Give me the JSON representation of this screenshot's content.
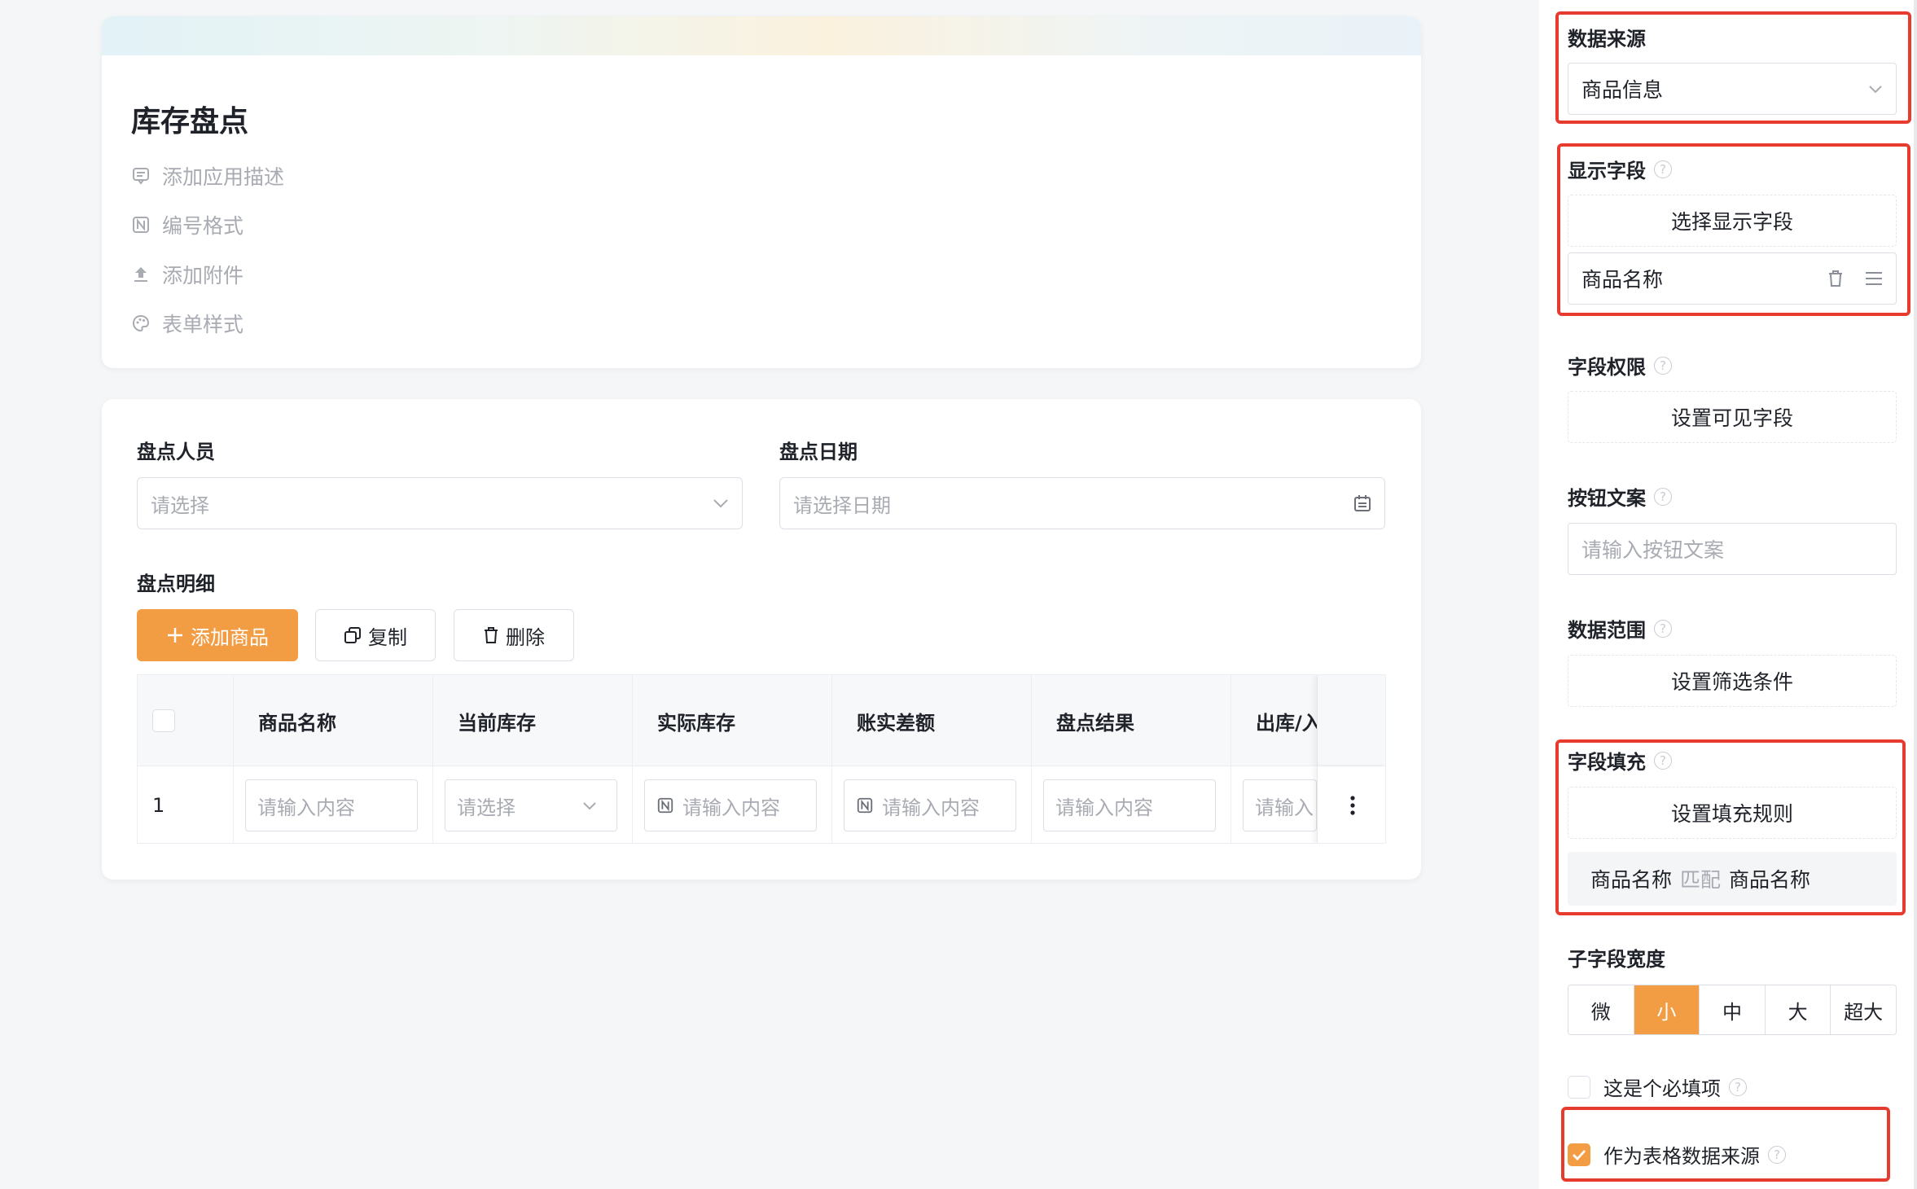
{
  "app": {
    "title": "库存盘点",
    "meta": [
      {
        "label": "添加应用描述",
        "icon": "comment-icon"
      },
      {
        "label": "编号格式",
        "icon": "number-icon"
      },
      {
        "label": "添加附件",
        "icon": "upload-icon"
      },
      {
        "label": "表单样式",
        "icon": "palette-icon"
      }
    ]
  },
  "form": {
    "person": {
      "label": "盘点人员",
      "placeholder": "请选择"
    },
    "date": {
      "label": "盘点日期",
      "placeholder": "请选择日期"
    },
    "detail": {
      "label": "盘点明细",
      "add_button": "添加商品",
      "copy_button": "复制",
      "delete_button": "删除",
      "columns": [
        "商品名称",
        "当前库存",
        "实际库存",
        "账实差额",
        "盘点结果",
        "出库/入"
      ],
      "rows": [
        {
          "index": "1",
          "cells": [
            "请输入内容",
            "请选择",
            "请输入内容",
            "请输入内容",
            "请输入内容",
            "请输入"
          ]
        }
      ]
    }
  },
  "panel": {
    "data_source": {
      "label": "数据来源",
      "value": "商品信息"
    },
    "display_fields": {
      "label": "显示字段",
      "button": "选择显示字段",
      "items": [
        "商品名称"
      ]
    },
    "field_permission": {
      "label": "字段权限",
      "button": "设置可见字段"
    },
    "button_text": {
      "label": "按钮文案",
      "placeholder": "请输入按钮文案"
    },
    "data_scope": {
      "label": "数据范围",
      "button": "设置筛选条件"
    },
    "field_fill": {
      "label": "字段填充",
      "button": "设置填充规则",
      "rule": {
        "from": "商品名称",
        "op": "匹配",
        "to": "商品名称"
      }
    },
    "sub_width": {
      "label": "子字段宽度",
      "options": [
        "微",
        "小",
        "中",
        "大",
        "超大"
      ],
      "selected": "小"
    },
    "required": {
      "label": "这是个必填项",
      "checked": false
    },
    "as_table_source": {
      "label": "作为表格数据来源",
      "checked": true
    }
  },
  "colors": {
    "accent": "#f29d44",
    "highlight": "#e63b2e"
  }
}
